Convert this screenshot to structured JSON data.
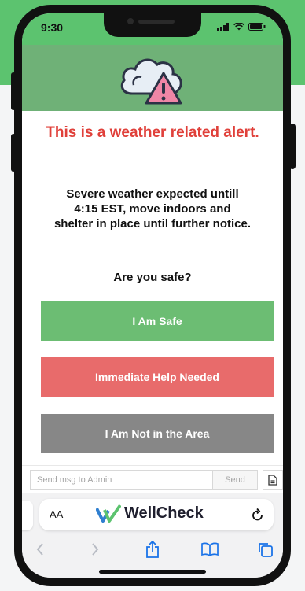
{
  "status_bar": {
    "time": "9:30"
  },
  "alert": {
    "icon": "cloud-warning-icon",
    "title": "This is a weather related alert.",
    "message": "Severe weather expected untill 4:15 EST, move indoors and shelter in place until further notice.",
    "question": "Are you safe?"
  },
  "actions": [
    {
      "label": "I Am Safe",
      "color": "#6cbd73"
    },
    {
      "label": "Immediate Help Needed",
      "color": "#e86b6b"
    },
    {
      "label": "I Am Not in the Area",
      "color": "#878787"
    }
  ],
  "message_bar": {
    "placeholder": "Send msg to Admin",
    "send_label": "Send"
  },
  "browser": {
    "text_size_label": "AA",
    "site_name": "WellCheck",
    "accent_color": "#5cc36f"
  }
}
